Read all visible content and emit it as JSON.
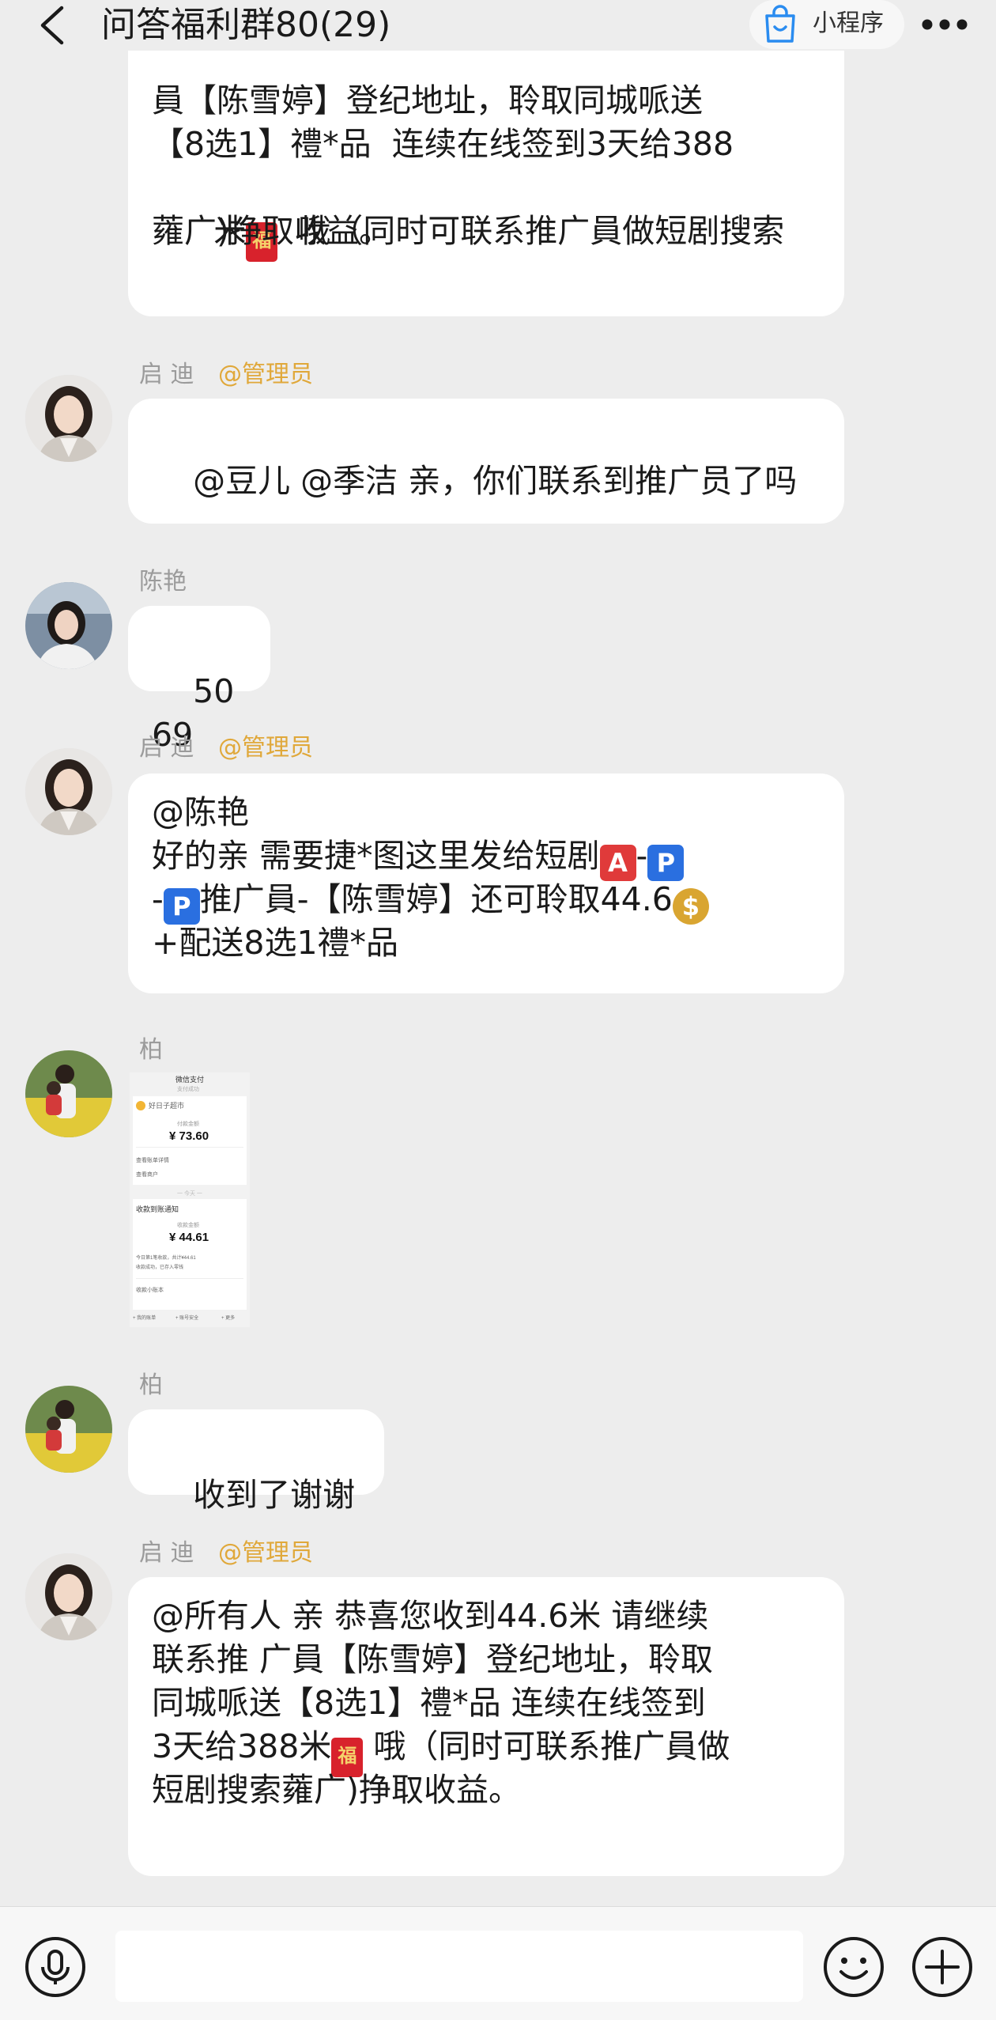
{
  "header": {
    "title": "问答福利群80(29)",
    "mini_program_label": "小程序"
  },
  "messages": [
    {
      "id": "m0",
      "text_lines": [
        "員【陈雪婷】登纪地址，聆取同城哌送",
        "【8选1】禮*品  连续在线签到3天给388",
        "米{env}  哦（同时可联系推广員做短剧搜索",
        "蕹广)挣取收益。"
      ]
    },
    {
      "id": "m1",
      "sender": "启 迪",
      "role": "@管理员",
      "text": "@豆儿 @季洁 亲，你们联系到推广员了吗"
    },
    {
      "id": "m2",
      "sender": "陈艳",
      "text": "5069"
    },
    {
      "id": "m3",
      "sender": "启 迪",
      "role": "@管理员",
      "line1": "@陈艳",
      "line2": "好的亲  需要捷*图这里发给短剧",
      "line3": "推广員-【陈雪婷】还可聆取44.6",
      "line4": "+配送8选1禮*品"
    },
    {
      "id": "m4",
      "sender": "柏",
      "image": {
        "header": "微信支付",
        "sub": "支付成功",
        "merchant": "好日子超市",
        "amount1_label": "付款金额",
        "amount1": "¥ 73.60",
        "row1": "查看账单详情",
        "row2": "查看商户",
        "divider": "一 今天 一",
        "notice": "收款到账通知",
        "amount2_label": "收款金额",
        "amount2": "¥ 44.61",
        "desc1": "今日第1笔收款，共计¥44.61",
        "desc2": "收款成功，已存入零钱",
        "row3": "收款小账本",
        "foot1": "+ 我的账单",
        "foot2": "+ 账号安全",
        "foot3": "+ 更多"
      }
    },
    {
      "id": "m5",
      "sender": "柏",
      "text": "收到了谢谢"
    },
    {
      "id": "m6",
      "sender": "启 迪",
      "role": "@管理员",
      "line1": "@所有人 亲   恭喜您收到44.6米 请继续",
      "line2": "联系推 广員【陈雪婷】登纪地址，聆取",
      "line3": "同城哌送【8选1】禮*品  连续在线签到",
      "line4a": "3天给388米",
      "line4b": " 哦（同时可联系推广員做",
      "line5": "短剧搜索蕹广)挣取收益。"
    }
  ],
  "emoji": {
    "a_button": "A",
    "p_button": "P",
    "money_bag": "$",
    "red_envelope": "福"
  },
  "input": {
    "placeholder": ""
  },
  "colors": {
    "background": "#ededed",
    "bubble": "#ffffff",
    "admin_tag": "#e0a83a",
    "name": "#9b9b9b"
  }
}
